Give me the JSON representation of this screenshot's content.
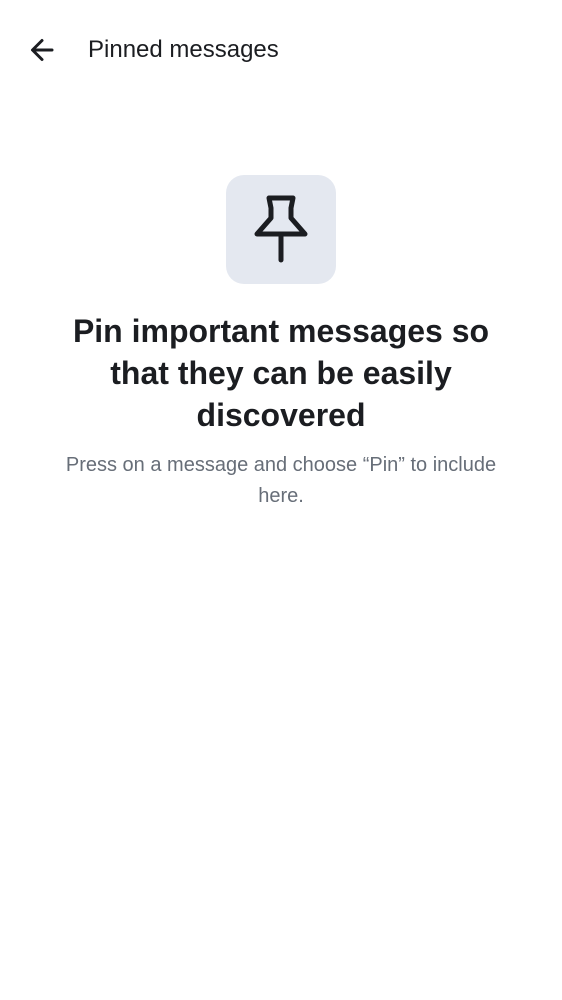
{
  "header": {
    "title": "Pinned messages",
    "back_icon": "arrow-left-icon"
  },
  "empty_state": {
    "icon": "pin-icon",
    "icon_tile_color": "#e4e8f0",
    "heading": "Pin important messages so that they can be easily discovered",
    "subtitle": "Press on a message and choose “Pin” to include here."
  }
}
